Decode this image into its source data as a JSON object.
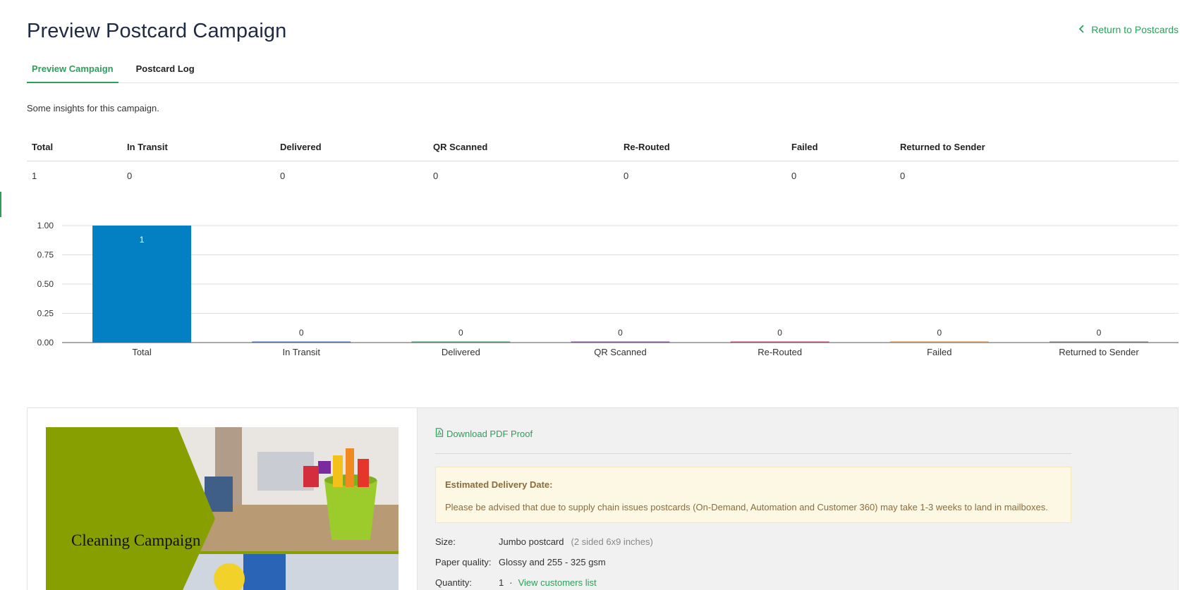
{
  "page": {
    "title": "Preview Postcard Campaign",
    "return_link": "Return to Postcards"
  },
  "tabs": [
    {
      "label": "Preview Campaign",
      "active": true
    },
    {
      "label": "Postcard Log",
      "active": false
    }
  ],
  "insights_text": "Some insights for this campaign.",
  "stats": {
    "headers": [
      "Total",
      "In Transit",
      "Delivered",
      "QR Scanned",
      "Re-Routed",
      "Failed",
      "Returned to Sender"
    ],
    "values": [
      "1",
      "0",
      "0",
      "0",
      "0",
      "0",
      "0"
    ]
  },
  "chart_data": {
    "type": "bar",
    "categories": [
      "Total",
      "In Transit",
      "Delivered",
      "QR Scanned",
      "Re-Routed",
      "Failed",
      "Returned to Sender"
    ],
    "values": [
      1,
      0,
      0,
      0,
      0,
      0,
      0
    ],
    "data_labels": [
      "1",
      "0",
      "0",
      "0",
      "0",
      "0",
      "0"
    ],
    "yticks": [
      "0.00",
      "0.25",
      "0.50",
      "0.75",
      "1.00"
    ],
    "ylim": [
      0,
      1
    ],
    "colors": [
      "#0380c4",
      "#3a6fd8",
      "#2e9e5b",
      "#8e44ad",
      "#d6336c",
      "#e67e22",
      "#6c757d"
    ],
    "grid": true,
    "title": "",
    "xlabel": "",
    "ylabel": ""
  },
  "postcard": {
    "title": "Cleaning Campaign",
    "colors": {
      "green": "#87a000",
      "floor": "#b89a74",
      "wall": "#e9e6e1",
      "bucket": "#9ccc2c"
    }
  },
  "download": {
    "label": "Download PDF Proof"
  },
  "notice": {
    "title": "Estimated Delivery Date:",
    "body": "Please be advised that due to supply chain issues postcards (On-Demand, Automation and Customer 360) may take 1-3 weeks to land in mailboxes."
  },
  "details": {
    "size": {
      "label": "Size:",
      "value": "Jumbo postcard",
      "sub": "(2 sided 6x9 inches)"
    },
    "paper": {
      "label": "Paper quality:",
      "value": "Glossy and 255 - 325 gsm"
    },
    "quantity": {
      "label": "Quantity:",
      "value": "1",
      "separator": "·",
      "link": "View customers list"
    }
  },
  "colors": {
    "accent": "#2e9e5b",
    "title": "#1f2a44"
  }
}
